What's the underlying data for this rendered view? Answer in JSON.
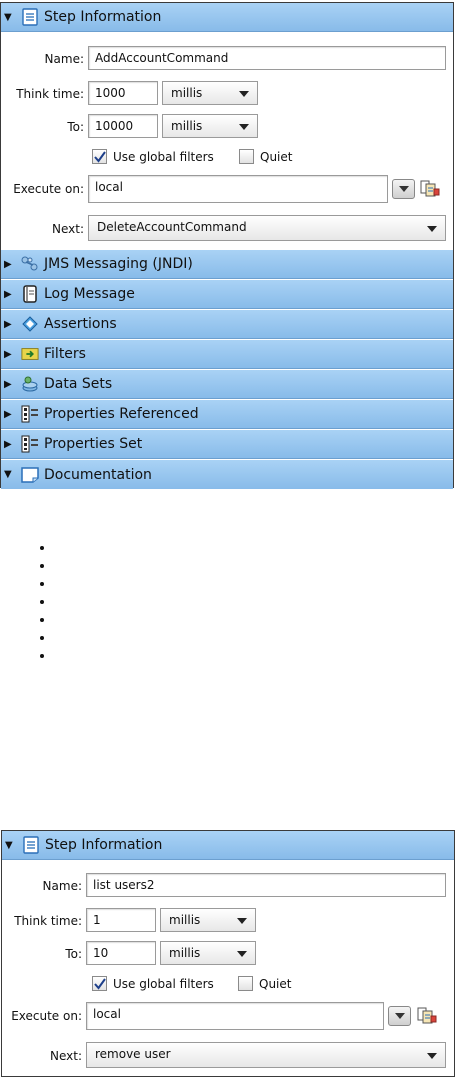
{
  "top_panel": {
    "step_info": {
      "title": "Step Information",
      "name_label": "Name:",
      "name_value": "AddAccountCommand",
      "think_label": "Think time:",
      "think_value": "1000",
      "think_unit": "millis",
      "to_label": "To:",
      "to_value": "10000",
      "to_unit": "millis",
      "global_filters_label": "Use global filters",
      "global_filters_checked": true,
      "quiet_label": "Quiet",
      "quiet_checked": false,
      "execute_label": "Execute on:",
      "execute_value": "local",
      "next_label": "Next:",
      "next_value": "DeleteAccountCommand"
    },
    "sections": [
      {
        "label": "JMS Messaging (JNDI)",
        "icon": "jms-icon",
        "expanded": false
      },
      {
        "label": "Log Message",
        "icon": "log-message-icon",
        "expanded": false
      },
      {
        "label": "Assertions",
        "icon": "assertions-icon",
        "expanded": false
      },
      {
        "label": "Filters",
        "icon": "filters-icon",
        "expanded": false
      },
      {
        "label": "Data Sets",
        "icon": "data-sets-icon",
        "expanded": false
      },
      {
        "label": "Properties Referenced",
        "icon": "properties-icon",
        "expanded": false
      },
      {
        "label": "Properties Set",
        "icon": "properties-icon",
        "expanded": false
      },
      {
        "label": "Documentation",
        "icon": "documentation-icon",
        "expanded": true
      }
    ]
  },
  "bottom_panel": {
    "step_info": {
      "title": "Step Information",
      "name_label": "Name:",
      "name_value": "list users2",
      "think_label": "Think time:",
      "think_value": "1",
      "think_unit": "millis",
      "to_label": "To:",
      "to_value": "10",
      "to_unit": "millis",
      "global_filters_label": "Use global filters",
      "global_filters_checked": true,
      "quiet_label": "Quiet",
      "quiet_checked": false,
      "execute_label": "Execute on:",
      "execute_value": "local",
      "next_label": "Next:",
      "next_value": "remove user"
    }
  },
  "colors": {
    "header_light": "#a9d2f5",
    "header_dark": "#88bbe9",
    "border": "#3a3a3a"
  }
}
